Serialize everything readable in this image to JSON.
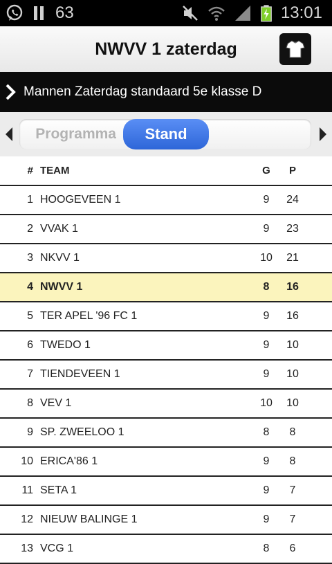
{
  "status_bar": {
    "icons_left": [
      "whatsapp-icon",
      "pause-icon"
    ],
    "notification_count": "63",
    "icons_right": [
      "mute-icon",
      "wifi-icon",
      "signal-icon",
      "battery-charging-icon"
    ],
    "time": "13:01"
  },
  "header": {
    "title": "NWVV 1 zaterdag",
    "shirt_icon": "shirt-icon"
  },
  "league": {
    "label": "Mannen Zaterdag standaard 5e klasse D"
  },
  "tabs": {
    "items": [
      {
        "label": "Programma",
        "active": false
      },
      {
        "label": "Stand",
        "active": true
      }
    ],
    "accent": "#2e66d8"
  },
  "table": {
    "columns": [
      "#",
      "TEAM",
      "G",
      "P"
    ],
    "highlight_color": "#fbf4bd",
    "rows": [
      {
        "rank": "1",
        "team": "HOOGEVEEN 1",
        "g": "9",
        "p": "24"
      },
      {
        "rank": "2",
        "team": "VVAK 1",
        "g": "9",
        "p": "23"
      },
      {
        "rank": "3",
        "team": "NKVV 1",
        "g": "10",
        "p": "21"
      },
      {
        "rank": "4",
        "team": "NWVV 1",
        "g": "8",
        "p": "16",
        "highlight": true
      },
      {
        "rank": "5",
        "team": "TER APEL '96 FC 1",
        "g": "9",
        "p": "16"
      },
      {
        "rank": "6",
        "team": "TWEDO 1",
        "g": "9",
        "p": "10"
      },
      {
        "rank": "7",
        "team": "TIENDEVEEN 1",
        "g": "9",
        "p": "10"
      },
      {
        "rank": "8",
        "team": "VEV 1",
        "g": "10",
        "p": "10"
      },
      {
        "rank": "9",
        "team": "SP. ZWEELOO 1",
        "g": "8",
        "p": "8"
      },
      {
        "rank": "10",
        "team": "ERICA'86 1",
        "g": "9",
        "p": "8"
      },
      {
        "rank": "11",
        "team": "SETA 1",
        "g": "9",
        "p": "7"
      },
      {
        "rank": "12",
        "team": "NIEUW BALINGE 1",
        "g": "9",
        "p": "7"
      },
      {
        "rank": "13",
        "team": "VCG 1",
        "g": "8",
        "p": "6"
      }
    ]
  }
}
